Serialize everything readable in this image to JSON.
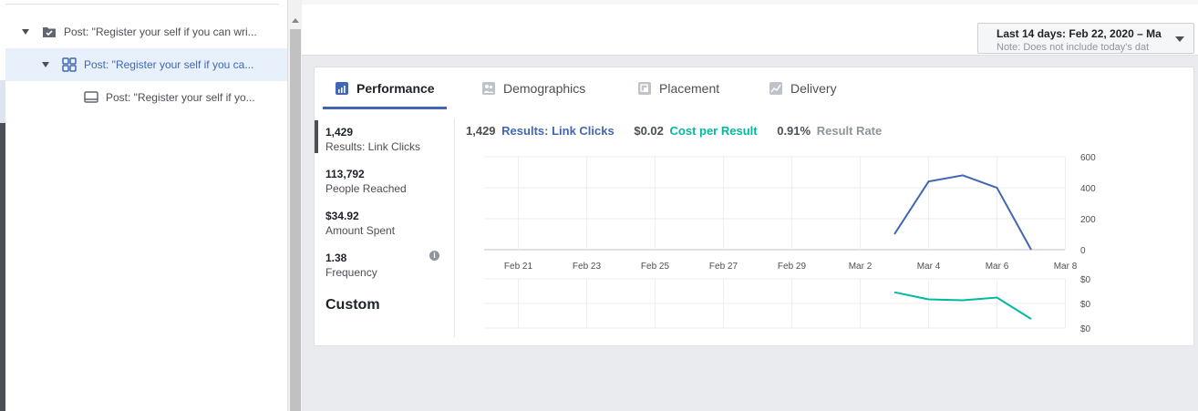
{
  "tree": {
    "items": [
      {
        "label": "Post: \"Register your self if you can wri..."
      },
      {
        "label": "Post: \"Register your self if you ca..."
      },
      {
        "label": "Post: \"Register your self if yo..."
      }
    ]
  },
  "daterange": {
    "line1": "Last 14 days: Feb 22, 2020 – Ma",
    "line2": "Note: Does not include today's dat"
  },
  "tabs": [
    {
      "label": "Performance",
      "icon": "bar-chart-icon"
    },
    {
      "label": "Demographics",
      "icon": "people-icon"
    },
    {
      "label": "Placement",
      "icon": "placement-icon"
    },
    {
      "label": "Delivery",
      "icon": "delivery-icon"
    }
  ],
  "metrics": [
    {
      "value": "1,429",
      "label": "Results: Link Clicks"
    },
    {
      "value": "113,792",
      "label": "People Reached"
    },
    {
      "value": "$34.92",
      "label": "Amount Spent"
    },
    {
      "value": "1.38",
      "label": "Frequency"
    }
  ],
  "custom_label": "Custom",
  "info_glyph": "i",
  "summary": {
    "results_value": "1,429",
    "results_label": "Results: Link Clicks",
    "cpr_value": "$0.02",
    "cpr_label": "Cost per Result",
    "rate_value": "0.91%",
    "rate_label": "Result Rate"
  },
  "colors": {
    "results": "#4267b2",
    "cost": "#00b9a0",
    "rate": "#90949c"
  },
  "chart_data": [
    {
      "type": "line",
      "x": [
        "Feb 21",
        "Feb 23",
        "Feb 25",
        "Feb 27",
        "Feb 29",
        "Mar 2",
        "Mar 4",
        "Mar 6",
        "Mar 8"
      ],
      "series": [
        {
          "name": "Results: Link Clicks",
          "x": [
            "Mar 3",
            "Mar 4",
            "Mar 5",
            "Mar 6",
            "Mar 7"
          ],
          "values": [
            100,
            440,
            480,
            400,
            0
          ]
        }
      ],
      "y_ticks": [
        "600",
        "400",
        "200",
        "0"
      ],
      "ylim": [
        0,
        600
      ],
      "grid": true
    },
    {
      "type": "line",
      "series": [
        {
          "name": "Cost per Result",
          "x": [
            "Mar 3",
            "Mar 4",
            "Mar 5",
            "Mar 6",
            "Mar 7"
          ],
          "values": [
            0.03,
            0.022,
            0.021,
            0.024,
            0.0
          ]
        }
      ],
      "y_ticks": [
        "$0",
        "$0",
        "$0"
      ],
      "grid": true
    }
  ]
}
